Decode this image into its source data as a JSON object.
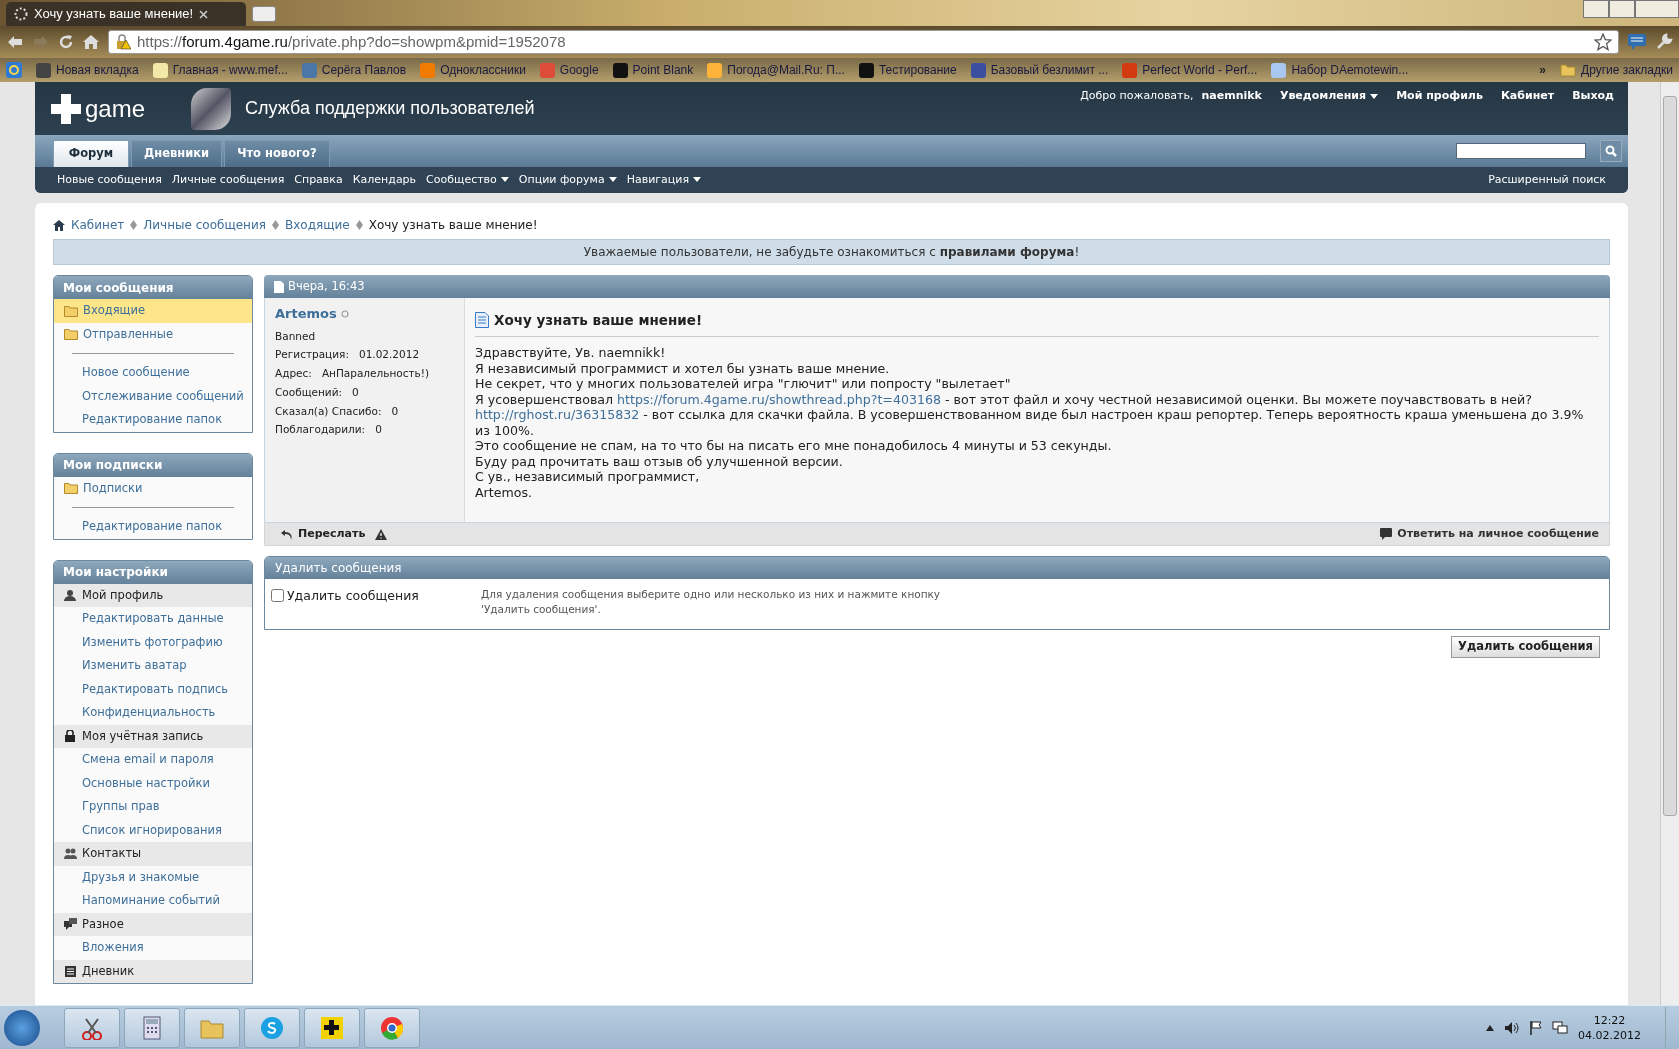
{
  "browser": {
    "tab_title": "Хочу узнать ваше мнение!",
    "url_scheme": "https://",
    "url_host": "forum.4game.ru",
    "url_path": "/private.php?do=showpm&pmid=1952078",
    "bookmarks": [
      {
        "label": "Новая вкладка"
      },
      {
        "label": "Главная - www.mef..."
      },
      {
        "label": "Серёга Павлов"
      },
      {
        "label": "Одноклассники"
      },
      {
        "label": "Google"
      },
      {
        "label": "Point Blank"
      },
      {
        "label": "Погода@Mail.Ru: П..."
      },
      {
        "label": "Тестирование"
      },
      {
        "label": "Базовый безлимит ..."
      },
      {
        "label": "Perfect World - Perf..."
      },
      {
        "label": "Набор DAemotewin..."
      }
    ],
    "more_bookmarks": "»",
    "other_bookmarks": "Другие закладки"
  },
  "header": {
    "logo_text": "game",
    "site_title": "Служба поддержки пользователей",
    "welcome": "Добро пожаловать,",
    "username": "naemnikk",
    "user_links": [
      {
        "label": "Уведомления",
        "dropdown": true
      },
      {
        "label": "Мой профиль",
        "dropdown": false
      },
      {
        "label": "Кабинет",
        "dropdown": false
      },
      {
        "label": "Выход",
        "dropdown": false
      }
    ],
    "tabs": [
      {
        "label": "Форум",
        "selected": true
      },
      {
        "label": "Дневники",
        "selected": false
      },
      {
        "label": "Что нового?",
        "selected": false
      }
    ],
    "subnav": [
      {
        "label": "Новые сообщения",
        "dropdown": false
      },
      {
        "label": "Личные сообщения",
        "dropdown": false
      },
      {
        "label": "Справка",
        "dropdown": false
      },
      {
        "label": "Календарь",
        "dropdown": false
      },
      {
        "label": "Сообщество",
        "dropdown": true
      },
      {
        "label": "Опции форума",
        "dropdown": true
      },
      {
        "label": "Навигация",
        "dropdown": true
      }
    ],
    "advanced_search": "Расширенный поиск"
  },
  "breadcrumbs": [
    "Кабинет",
    "Личные сообщения",
    "Входящие"
  ],
  "current_page": "Хочу узнать ваше мнение!",
  "notice": "Уважаемые пользователи, не забудьте ознакомиться с **правилами форума**!",
  "sidebar": [
    {
      "title": "Мои сообщения",
      "items": [
        {
          "label": "Входящие",
          "kind": "folder",
          "selected": true
        },
        {
          "label": "Отправленные",
          "kind": "folder",
          "selected": false
        },
        {
          "label": "Новое сообщение",
          "kind": "link",
          "selected": false
        },
        {
          "label": "Отслеживание сообщений",
          "kind": "link",
          "selected": false
        },
        {
          "label": "Редактирование папок",
          "kind": "link",
          "selected": false
        }
      ]
    },
    {
      "title": "Мои подписки",
      "items": [
        {
          "label": "Подписки",
          "kind": "folder",
          "selected": false
        },
        {
          "label": "Редактирование папок",
          "kind": "link",
          "selected": false
        }
      ]
    },
    {
      "title": "Мои настройки",
      "items": [
        {
          "label": "Мой профиль",
          "kind": "section",
          "selected": false
        },
        {
          "label": "Редактировать данные",
          "kind": "link",
          "selected": false
        },
        {
          "label": "Изменить фотографию",
          "kind": "link",
          "selected": false
        },
        {
          "label": "Изменить аватар",
          "kind": "link",
          "selected": false
        },
        {
          "label": "Редактировать подпись",
          "kind": "link",
          "selected": false
        },
        {
          "label": "Конфиденциальность",
          "kind": "link",
          "selected": false
        },
        {
          "label": "Моя учётная запись",
          "kind": "section",
          "selected": false
        },
        {
          "label": "Смена email и пароля",
          "kind": "link",
          "selected": false
        },
        {
          "label": "Основные настройки",
          "kind": "link",
          "selected": false
        },
        {
          "label": "Группы прав",
          "kind": "link",
          "selected": false
        },
        {
          "label": "Список игнорирования",
          "kind": "link",
          "selected": false
        },
        {
          "label": "Контакты",
          "kind": "section",
          "selected": false
        },
        {
          "label": "Друзья и знакомые",
          "kind": "link",
          "selected": false
        },
        {
          "label": "Напоминание событий",
          "kind": "link",
          "selected": false
        },
        {
          "label": "Разное",
          "kind": "section",
          "selected": false
        },
        {
          "label": "Вложения",
          "kind": "link",
          "selected": false
        },
        {
          "label": "Дневник",
          "kind": "section",
          "selected": false
        }
      ]
    }
  ],
  "post": {
    "date": "Вчера, 16:43",
    "author": "Artemos",
    "online": false,
    "rank": "Banned",
    "stats": [
      {
        "label": "Регистрация:",
        "value": "01.02.2012"
      },
      {
        "label": "Адрес:",
        "value": "АнПаралельность!)"
      },
      {
        "label": "Сообщений:",
        "value": "0"
      },
      {
        "label": "Сказал(а) Спасибо:",
        "value": "0"
      },
      {
        "label": "Поблагодарили:",
        "value": "0"
      }
    ],
    "title": "Хочу узнать ваше мнение!",
    "body": [
      [
        {
          "kind": "text",
          "text": "Здравствуйте, Ув. naemnikk!"
        }
      ],
      [
        {
          "kind": "text",
          "text": "Я независимый программист и хотел бы узнать ваше мнение."
        }
      ],
      [
        {
          "kind": "text",
          "text": "Не секрет, что у многих пользователей игра \"глючит\" или попросту \"вылетает\""
        }
      ],
      [
        {
          "kind": "text",
          "text": "Я усовершенствовал "
        },
        {
          "kind": "link",
          "text": "https://forum.4game.ru/showthread.php?t=403168"
        },
        {
          "kind": "text",
          "text": " - вот этот файл и хочу честной независимой оценки. Вы можете поучавствовать в ней?"
        }
      ],
      [
        {
          "kind": "link",
          "text": "http://rghost.ru/36315832"
        },
        {
          "kind": "text",
          "text": " - вот ссылка для скачки файла. В усовершенствованном виде был настроен краш репортер. Теперь вероятность краша уменьшена до 3.9% из 100%."
        }
      ],
      [
        {
          "kind": "text",
          "text": "Это сообщение не спам, на то что бы на писать его мне понадобилось 4 минуты и 53 секунды."
        }
      ],
      [
        {
          "kind": "text",
          "text": "Буду рад прочитать ваш отзыв об улучшенной версии."
        }
      ],
      [
        {
          "kind": "text",
          "text": "С ув., независимый программист,"
        }
      ],
      [
        {
          "kind": "text",
          "text": "Artemos."
        }
      ]
    ],
    "forward": "Переслать",
    "reply": "Ответить на личное сообщение"
  },
  "delete_panel": {
    "title": "Удалить сообщения",
    "checkbox_label": "Удалить сообщения",
    "checked": false,
    "hint": "Для удаления сообщения выберите одно или несколько из них и нажмите кнопку 'Удалить сообщения'.",
    "button": "Удалить сообщения"
  },
  "taskbar": {
    "time": "12:22",
    "date": "04.02.2012"
  }
}
